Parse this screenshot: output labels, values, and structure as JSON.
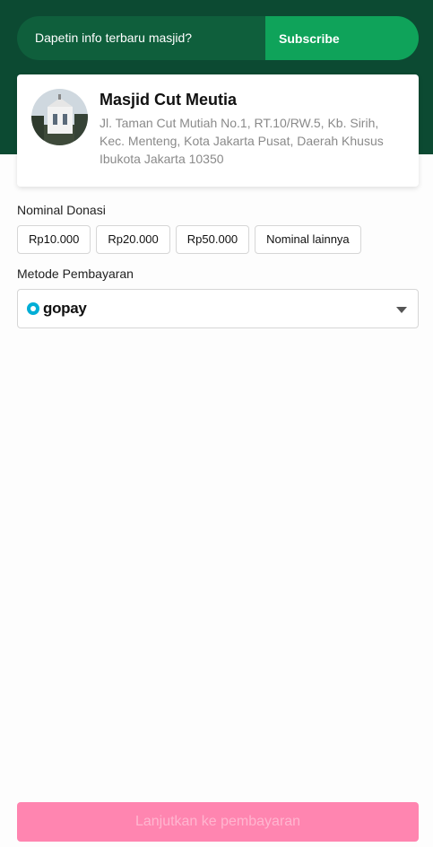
{
  "subscribe": {
    "prompt": "Dapetin info terbaru masjid?",
    "button": "Subscribe"
  },
  "mosque": {
    "name": "Masjid Cut Meutia",
    "address": "Jl. Taman Cut Mutiah No.1, RT.10/RW.5, Kb. Sirih, Kec. Menteng, Kota Jakarta Pusat, Daerah Khusus Ibukota Jakarta 10350"
  },
  "donation": {
    "label": "Nominal Donasi",
    "options": [
      "Rp10.000",
      "Rp20.000",
      "Rp50.000",
      "Nominal lainnya"
    ]
  },
  "payment": {
    "label": "Metode Pembayaran",
    "selected": "gopay",
    "icon": "gopay-logo-icon"
  },
  "cta": {
    "label": "Lanjutkan ke pembayaran"
  },
  "colors": {
    "header_bg": "#0c4a32",
    "subscribe_bg": "#0f5f3c",
    "subscribe_button": "#0fa35a",
    "cta_bg": "#ff85b0",
    "gopay_blue": "#00aed6"
  }
}
